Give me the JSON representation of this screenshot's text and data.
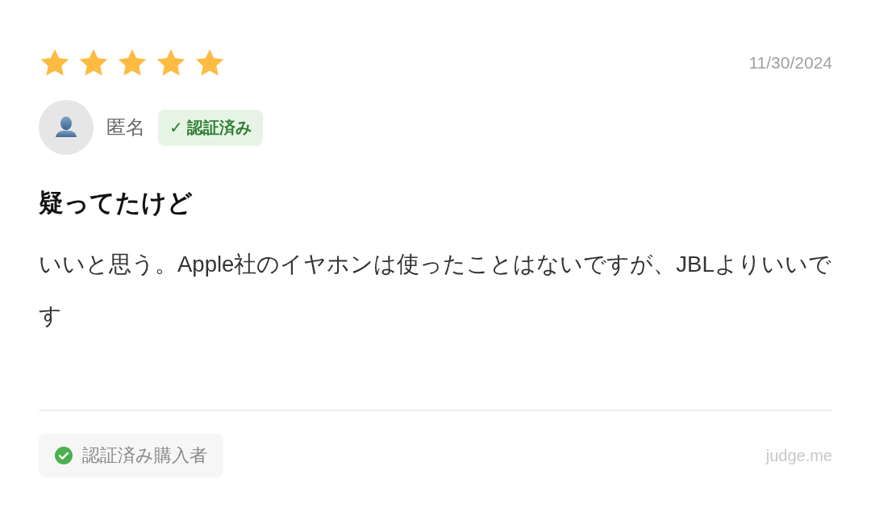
{
  "review": {
    "stars": 5,
    "date": "11/30/2024",
    "author": {
      "name": "匿名",
      "badge": "✓ 認証済み"
    },
    "title": "疑ってたけど",
    "body": "いいと思う。Apple社のイヤホンは使ったことはないですが、JBLよりいいです",
    "footer": {
      "purchase_badge": "認証済み購入者",
      "source": "judge.me"
    }
  }
}
